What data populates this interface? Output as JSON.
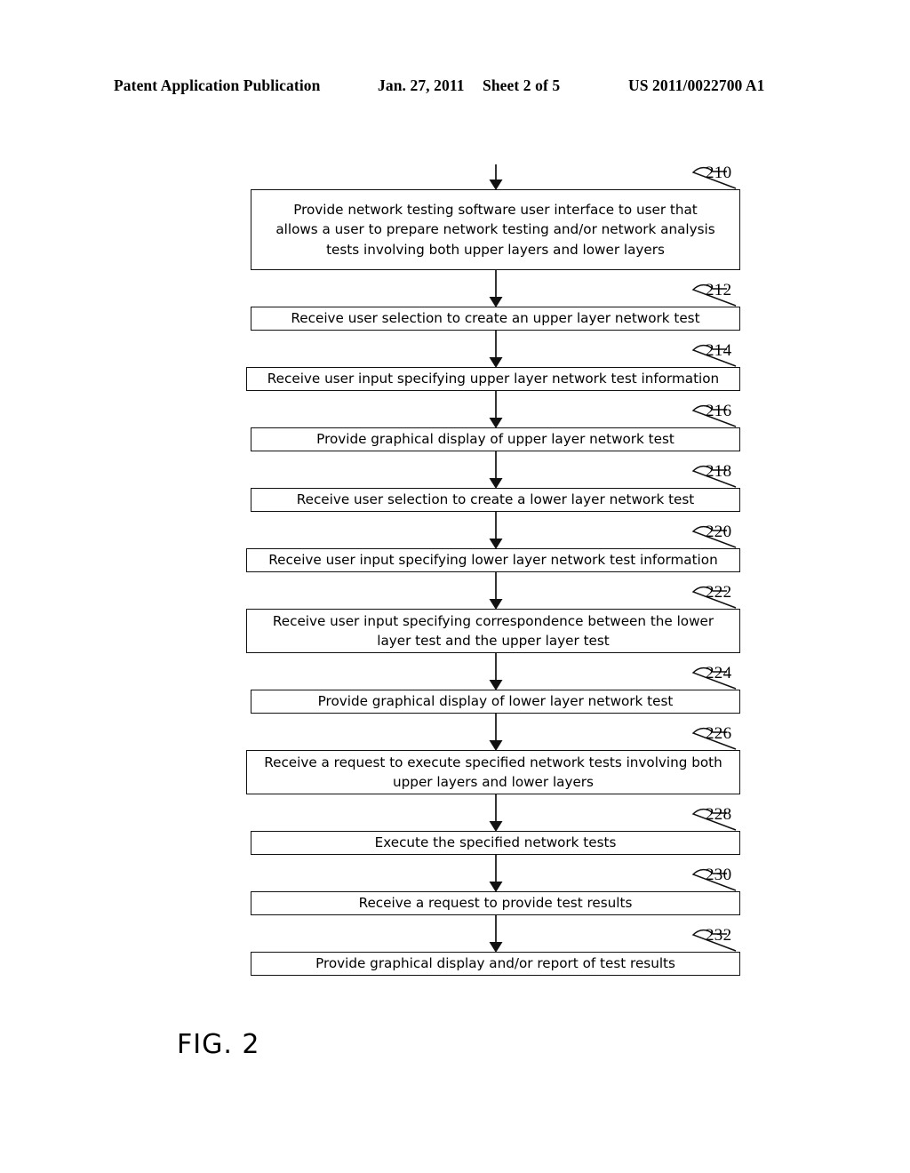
{
  "header": {
    "publication": "Patent Application Publication",
    "date": "Jan. 27, 2011",
    "sheet": "Sheet 2 of 5",
    "patent_number": "US 2011/0022700 A1"
  },
  "figure": {
    "caption": "FIG. 2",
    "title": "Flowchart of network testing method"
  },
  "colors": {
    "ink": "#111111",
    "page": "#ffffff"
  },
  "flowchart": {
    "entry_arrow": true,
    "steps": [
      {
        "ref": "210",
        "text": "Provide network testing software user interface to user that\nallows a user to prepare network testing and/or network analysis\ntests involving both upper layers and lower layers",
        "lines": 3
      },
      {
        "ref": "212",
        "text": "Receive user selection to create an upper layer network test",
        "lines": 1
      },
      {
        "ref": "214",
        "text": "Receive user input specifying upper layer network test information",
        "lines": 1
      },
      {
        "ref": "216",
        "text": "Provide graphical display of upper layer network test",
        "lines": 1
      },
      {
        "ref": "218",
        "text": "Receive user selection to create a lower layer network test",
        "lines": 1
      },
      {
        "ref": "220",
        "text": "Receive user input specifying lower layer network test information",
        "lines": 1
      },
      {
        "ref": "222",
        "text": "Receive user input specifying correspondence between the lower\nlayer test and the upper layer test",
        "lines": 2
      },
      {
        "ref": "224",
        "text": "Provide graphical display of lower layer network test",
        "lines": 1
      },
      {
        "ref": "226",
        "text": "Receive a request to execute specified network tests involving both\nupper layers and lower layers",
        "lines": 2
      },
      {
        "ref": "228",
        "text": "Execute the specified network tests",
        "lines": 1
      },
      {
        "ref": "230",
        "text": "Receive a request to provide test results",
        "lines": 1
      },
      {
        "ref": "232",
        "text": "Provide graphical display and/or report of test results",
        "lines": 1
      }
    ]
  }
}
